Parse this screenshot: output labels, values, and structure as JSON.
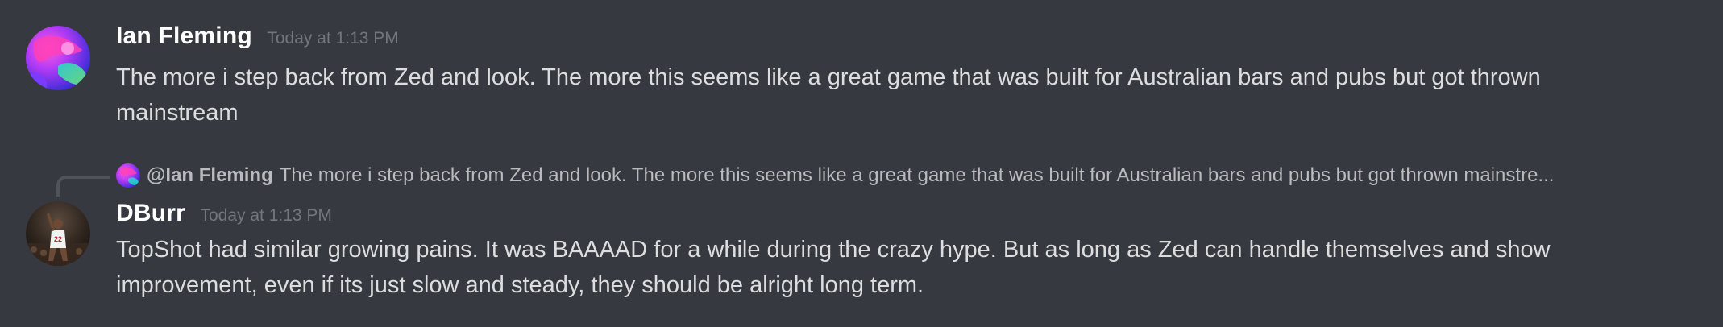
{
  "messages": [
    {
      "username": "Ian Fleming",
      "timestamp": "Today at 1:13 PM",
      "content": "The more i step back from Zed and look. The more this seems like a great game that was built for Australian bars and pubs but got thrown mainstream",
      "avatar_icon": "abstract-swirl-avatar",
      "username_color": "#ffffff"
    },
    {
      "reply": {
        "mention": "@Ian Fleming",
        "text": "The more i step back from Zed and look. The more this seems like a great game that was built for Australian bars and pubs but got thrown mainstre..."
      },
      "username": "DBurr",
      "timestamp": "Today at 1:13 PM",
      "content": "TopShot had similar growing pains. It was BAAAAD for a while during the crazy hype. But as long as Zed can handle themselves and show improvement, even if its just slow and steady, they should be alright long term.",
      "avatar_icon": "basketball-player-avatar",
      "username_color": "#ffffff"
    }
  ],
  "theme": {
    "background": "#36393f",
    "text": "#dcddde",
    "muted": "#72767d"
  }
}
